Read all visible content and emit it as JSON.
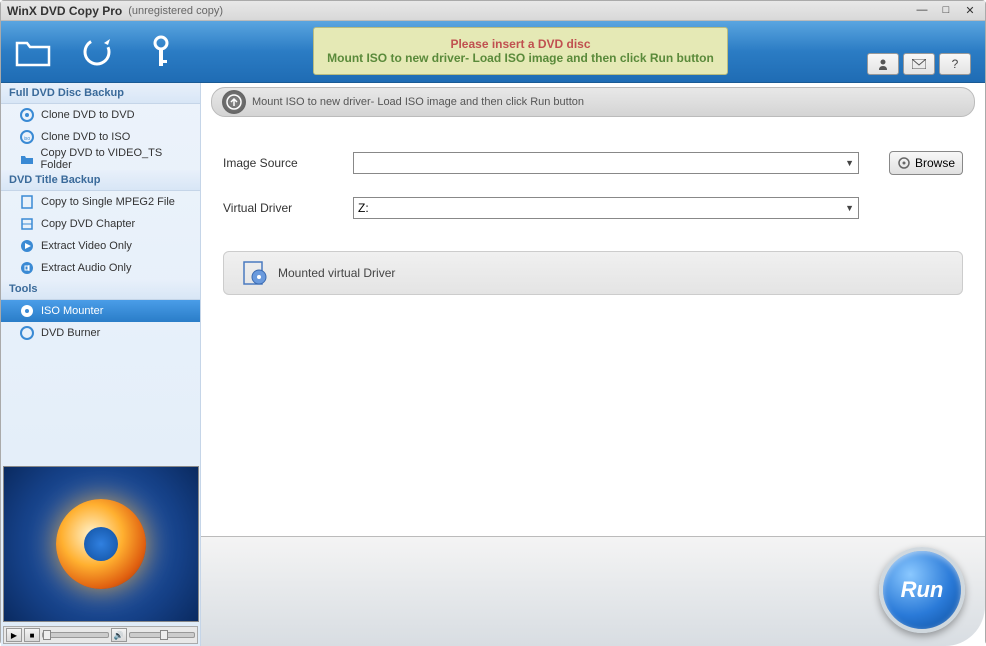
{
  "titlebar": {
    "title": "WinX DVD Copy Pro",
    "subtitle": "(unregistered copy)"
  },
  "notice": {
    "line1": "Please insert a DVD disc",
    "line2": "Mount ISO to new driver- Load ISO image and then click Run button"
  },
  "sidebar": {
    "section1": "Full DVD Disc Backup",
    "items1": [
      {
        "label": "Clone DVD to DVD"
      },
      {
        "label": "Clone DVD to ISO"
      },
      {
        "label": "Copy DVD to VIDEO_TS Folder"
      }
    ],
    "section2": "DVD Title Backup",
    "items2": [
      {
        "label": "Copy to Single MPEG2 File"
      },
      {
        "label": "Copy DVD Chapter"
      },
      {
        "label": "Extract Video Only"
      },
      {
        "label": "Extract Audio Only"
      }
    ],
    "section3": "Tools",
    "items3": [
      {
        "label": "ISO Mounter"
      },
      {
        "label": "DVD Burner"
      }
    ]
  },
  "main": {
    "header_text": "Mount ISO to new driver- Load ISO image and then click Run button",
    "image_source_label": "Image Source",
    "image_source_value": "",
    "virtual_driver_label": "Virtual Driver",
    "virtual_driver_value": "Z:",
    "browse_label": "Browse",
    "mounted_label": "Mounted virtual Driver",
    "run_label": "Run"
  }
}
